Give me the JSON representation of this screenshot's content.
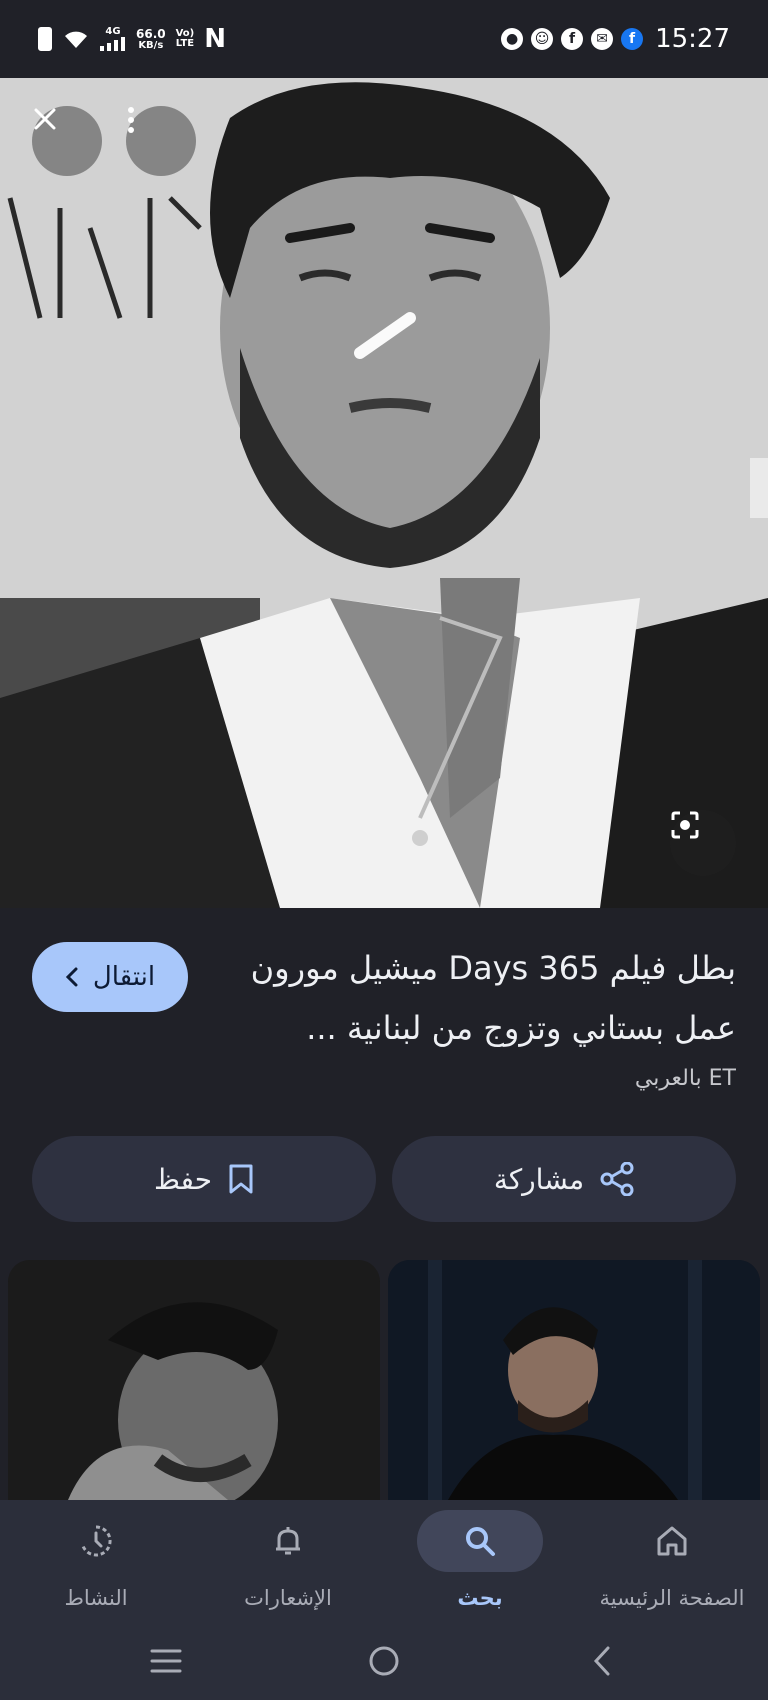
{
  "status_bar": {
    "network": "4G",
    "speed_value": "66.0",
    "speed_unit": "KB/s",
    "volte_top": "Vo)",
    "volte_bottom": "LTE",
    "n_logo": "N",
    "time": "15:27",
    "app_icons": [
      "chat-bubble-icon",
      "snapchat-icon",
      "facebook-icon",
      "messenger-icon",
      "facebook-icon"
    ]
  },
  "viewer": {
    "close_icon": "close-icon",
    "more_icon": "more-vert-icon",
    "lens_icon": "lens-icon",
    "image_subject": "portrait of a man"
  },
  "result": {
    "title": "بطل فيلم Days 365 ميشيل مورون عمل بستاني وتزوج من لبنانية ...",
    "source": "ET بالعربي",
    "visit_label": "انتقال"
  },
  "actions": {
    "share_label": "مشاركة",
    "save_label": "حفظ"
  },
  "bottom_nav": {
    "items": [
      {
        "label": "الصفحة الرئيسية",
        "icon": "home-icon",
        "active": false
      },
      {
        "label": "بحث",
        "icon": "search-icon",
        "active": true
      },
      {
        "label": "الإشعارات",
        "icon": "bell-icon",
        "active": false
      },
      {
        "label": "النشاط",
        "icon": "activity-icon",
        "active": false
      }
    ]
  },
  "colors": {
    "background": "#202128",
    "accent": "#a8c7fa",
    "button_bg": "#2e3140",
    "nav_bg": "#2b2e3a"
  }
}
